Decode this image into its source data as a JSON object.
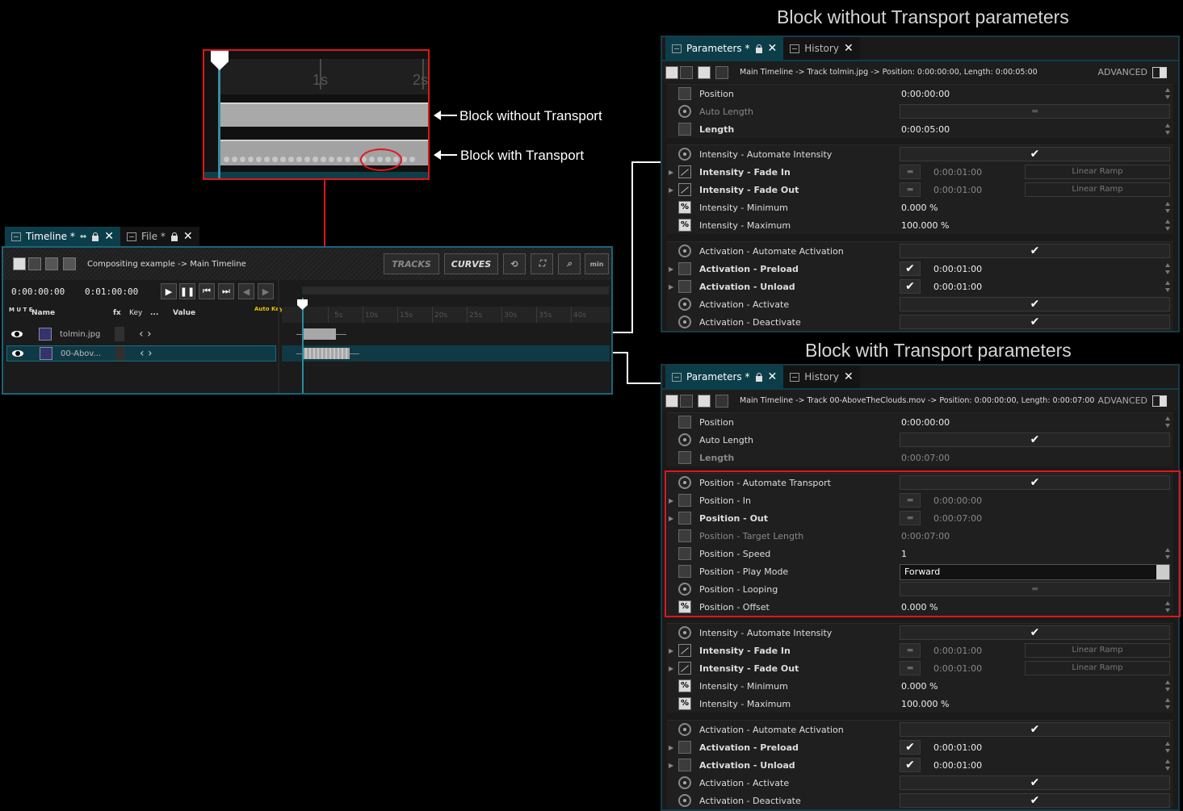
{
  "titles": {
    "without": "Block without Transport parameters",
    "with": "Block with Transport parameters"
  },
  "callouts": {
    "without": "Block without Transport",
    "with": "Block with Transport"
  },
  "zoom": {
    "tick_1": "1s",
    "tick_2": "2s"
  },
  "timeline": {
    "tab_label": "Timeline *",
    "file_tab": "File *",
    "breadcrumb": "Compositing example -> Main Timeline",
    "btn_tracks": "TRACKS",
    "btn_curves": "CURVES",
    "btn_min": "min",
    "time_start": "0:00:00:00",
    "time_end": "0:01:00:00",
    "col_mute": "M U T E",
    "col_name": "Name",
    "col_fx": "fx",
    "col_key": "Key",
    "col_dots": "...",
    "col_value": "Value",
    "col_autokey": "Auto Key",
    "ruler": [
      "5s",
      "10s",
      "15s",
      "20s",
      "25s",
      "30s",
      "35s",
      "40s"
    ],
    "tracks": [
      {
        "name": "tolmin.jpg"
      },
      {
        "name": "00-Abov..."
      }
    ]
  },
  "panel_a": {
    "tab_params": "Parameters *",
    "tab_history": "History",
    "path": "Main Timeline -> Track tolmin.jpg -> Position: 0:00:00:00, Length: 0:00:05:00",
    "advanced": "ADVANCED",
    "group1": [
      {
        "name": "Position",
        "value": "0:00:00:00"
      },
      {
        "name": "Auto Length",
        "value": ""
      },
      {
        "name": "Length",
        "value": "0:00:05:00"
      }
    ],
    "group2": [
      {
        "name": "Intensity - Automate Intensity",
        "value": "✔"
      },
      {
        "name": "Intensity - Fade In",
        "value": "0:00:01:00",
        "ramp": "Linear Ramp"
      },
      {
        "name": "Intensity - Fade Out",
        "value": "0:00:01:00",
        "ramp": "Linear Ramp"
      },
      {
        "name": "Intensity - Minimum",
        "value": "0.000 %"
      },
      {
        "name": "Intensity - Maximum",
        "value": "100.000 %"
      }
    ],
    "group3": [
      {
        "name": "Activation - Automate Activation",
        "value": "✔"
      },
      {
        "name": "Activation - Preload",
        "value": "0:00:01:00"
      },
      {
        "name": "Activation - Unload",
        "value": "0:00:01:00"
      },
      {
        "name": "Activation - Activate",
        "value": "✔"
      },
      {
        "name": "Activation - Deactivate",
        "value": "✔"
      }
    ]
  },
  "panel_b": {
    "tab_params": "Parameters *",
    "tab_history": "History",
    "path": "Main Timeline -> Track 00-AboveTheClouds.mov -> Position: 0:00:00:00, Length: 0:00:07:00",
    "advanced": "ADVANCED",
    "group1": [
      {
        "name": "Position",
        "value": "0:00:00:00"
      },
      {
        "name": "Auto Length",
        "value": "✔"
      },
      {
        "name": "Length",
        "value": "0:00:07:00"
      }
    ],
    "transport": [
      {
        "name": "Position - Automate Transport",
        "value": "✔"
      },
      {
        "name": "Position - In",
        "value": "0:00:00:00"
      },
      {
        "name": "Position - Out",
        "value": "0:00:07:00"
      },
      {
        "name": "Position - Target Length",
        "value": "0:00:07:00"
      },
      {
        "name": "Position - Speed",
        "value": "1"
      },
      {
        "name": "Position - Play Mode",
        "value": "Forward"
      },
      {
        "name": "Position - Looping",
        "value": ""
      },
      {
        "name": "Position - Offset",
        "value": "0.000 %"
      }
    ],
    "group2": [
      {
        "name": "Intensity - Automate Intensity",
        "value": "✔"
      },
      {
        "name": "Intensity - Fade In",
        "value": "0:00:01:00",
        "ramp": "Linear Ramp"
      },
      {
        "name": "Intensity - Fade Out",
        "value": "0:00:01:00",
        "ramp": "Linear Ramp"
      },
      {
        "name": "Intensity - Minimum",
        "value": "0.000 %"
      },
      {
        "name": "Intensity - Maximum",
        "value": "100.000 %"
      }
    ],
    "group3": [
      {
        "name": "Activation - Automate Activation",
        "value": "✔"
      },
      {
        "name": "Activation - Preload",
        "value": "0:00:01:00"
      },
      {
        "name": "Activation - Unload",
        "value": "0:00:01:00"
      },
      {
        "name": "Activation - Activate",
        "value": "✔"
      },
      {
        "name": "Activation - Deactivate",
        "value": "✔"
      }
    ]
  }
}
